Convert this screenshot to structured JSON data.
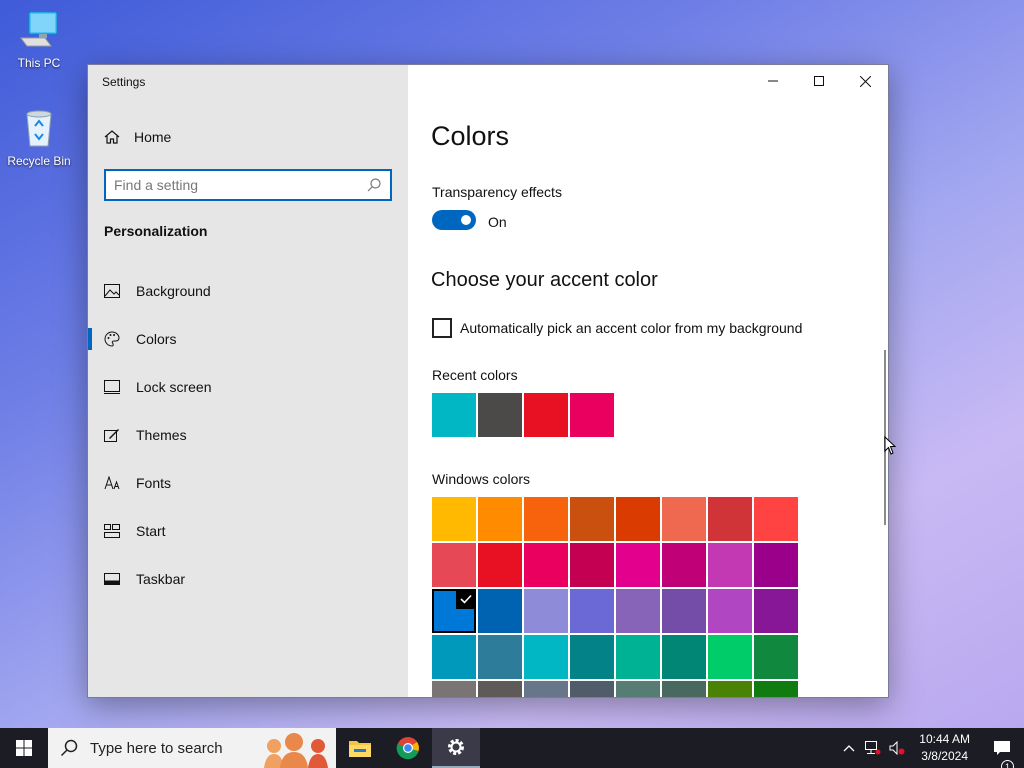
{
  "desktop": {
    "icons": [
      {
        "label": "This PC",
        "icon": "computer-icon"
      },
      {
        "label": "Recycle Bin",
        "icon": "recycle-bin-icon"
      }
    ]
  },
  "window": {
    "title": "Settings",
    "sidebar": {
      "home_label": "Home",
      "search_placeholder": "Find a setting",
      "section_heading": "Personalization",
      "items": [
        {
          "label": "Background",
          "icon": "background-icon",
          "active": false
        },
        {
          "label": "Colors",
          "icon": "palette-icon",
          "active": true
        },
        {
          "label": "Lock screen",
          "icon": "lock-screen-icon",
          "active": false
        },
        {
          "label": "Themes",
          "icon": "themes-icon",
          "active": false
        },
        {
          "label": "Fonts",
          "icon": "fonts-icon",
          "active": false
        },
        {
          "label": "Start",
          "icon": "start-icon",
          "active": false
        },
        {
          "label": "Taskbar",
          "icon": "taskbar-icon",
          "active": false
        }
      ]
    },
    "content": {
      "page_title": "Colors",
      "transparency_label": "Transparency effects",
      "transparency_state": "On",
      "accent_heading": "Choose your accent color",
      "auto_pick_label": "Automatically pick an accent color from my background",
      "recent_colors_label": "Recent colors",
      "recent_colors": [
        "#00b7c3",
        "#4c4a48",
        "#e81123",
        "#ea005e"
      ],
      "windows_colors_label": "Windows colors",
      "windows_colors": [
        "#ffb900",
        "#ff8c00",
        "#f7630c",
        "#ca5010",
        "#da3b01",
        "#ef6950",
        "#d13438",
        "#ff4343",
        "#e74856",
        "#e81123",
        "#ea005e",
        "#c30052",
        "#e3008c",
        "#bf0077",
        "#c239b3",
        "#9a0089",
        "#0078d7",
        "#0063b1",
        "#8e8cd8",
        "#6b69d6",
        "#8764b8",
        "#744da9",
        "#b146c2",
        "#881798",
        "#0099bc",
        "#2d7d9a",
        "#00b7c3",
        "#038387",
        "#00b294",
        "#018574",
        "#00cc6a",
        "#10893e",
        "#7a7574",
        "#5d5a58",
        "#68768a",
        "#515c6b",
        "#567c73",
        "#486860",
        "#498205",
        "#107c10"
      ],
      "selected_color_index": 16
    }
  },
  "taskbar": {
    "search_placeholder": "Type here to search",
    "time": "10:44 AM",
    "date": "3/8/2024",
    "notification_count": "1"
  }
}
